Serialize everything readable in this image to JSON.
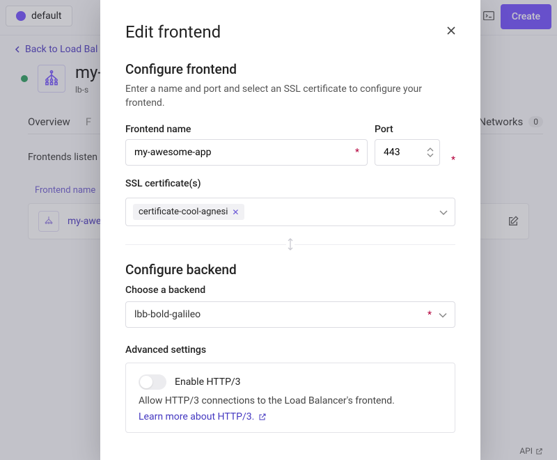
{
  "header": {
    "org_name": "default",
    "create_label": "Create"
  },
  "page": {
    "back_label": "Back to Load Bal",
    "lb_name_prefix": "my-",
    "lb_sub": "lb-s",
    "tabs": {
      "overview": "Overview",
      "private_networks": "Private Networks",
      "pn_count": "0"
    },
    "listen_text": "Frontends listen on",
    "table_header": "Frontend name",
    "card_name": "my-awesc",
    "api_label": "API"
  },
  "modal": {
    "title": "Edit frontend",
    "section1_title": "Configure frontend",
    "section1_desc": "Enter a name and port and select an SSL certificate to configure your frontend.",
    "name_label": "Frontend name",
    "name_value": "my-awesome-app",
    "port_label": "Port",
    "port_value": "443",
    "ssl_label": "SSL certificate(s)",
    "ssl_chip": "certificate-cool-agnesi",
    "section2_title": "Configure backend",
    "backend_label": "Choose a backend",
    "backend_value": "lbb-bold-galileo",
    "adv_label": "Advanced settings",
    "http3_toggle_label": "Enable HTTP/3",
    "http3_desc": "Allow HTTP/3 connections to the Load Balancer's frontend.",
    "http3_link": "Learn more about HTTP/3."
  }
}
